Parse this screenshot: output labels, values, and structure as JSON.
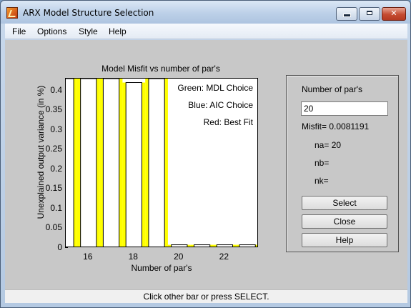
{
  "window": {
    "title": "ARX Model Structure Selection",
    "colors": {
      "client_bg": "#c8c8c8",
      "bar_yellow": "#ffff00",
      "status_bg": "#f0f0f0"
    }
  },
  "menu": {
    "items": [
      "File",
      "Options",
      "Style",
      "Help"
    ]
  },
  "plot": {
    "title": "Model Misfit vs number of par's",
    "legend": {
      "green": "Green: MDL Choice",
      "blue": "Blue: AIC Choice",
      "red": "Red: Best Fit"
    }
  },
  "controls": {
    "npar_label": "Number of par's",
    "npar_value": "20",
    "misfit_text": "Misfit=  0.0081191",
    "na_text": "na= 20",
    "nb_text": "nb=",
    "nk_text": "nk=",
    "select_label": "Select",
    "close_label": "Close",
    "help_label": "Help"
  },
  "status": {
    "text": "Click other bar or press SELECT."
  },
  "chart_data": {
    "type": "bar",
    "title": "Model Misfit vs number of par's",
    "xlabel": "Number of par's",
    "ylabel": "Unexplained output variance (in %)",
    "xlim": [
      15,
      23.5
    ],
    "ylim": [
      0,
      0.43
    ],
    "xticks": [
      "16",
      "18",
      "20",
      "22"
    ],
    "yticks": [
      "0",
      "0.05",
      "0.1",
      "0.15",
      "0.2",
      "0.25",
      "0.3",
      "0.35",
      "0.4"
    ],
    "x": [
      15,
      16,
      17,
      18,
      19,
      20,
      21,
      22,
      23
    ],
    "values": [
      0.43,
      0.43,
      0.43,
      0.42,
      0.43,
      0.0081,
      0.0081,
      0.0081,
      0.0081
    ],
    "bar_width": 1,
    "grid": false
  }
}
